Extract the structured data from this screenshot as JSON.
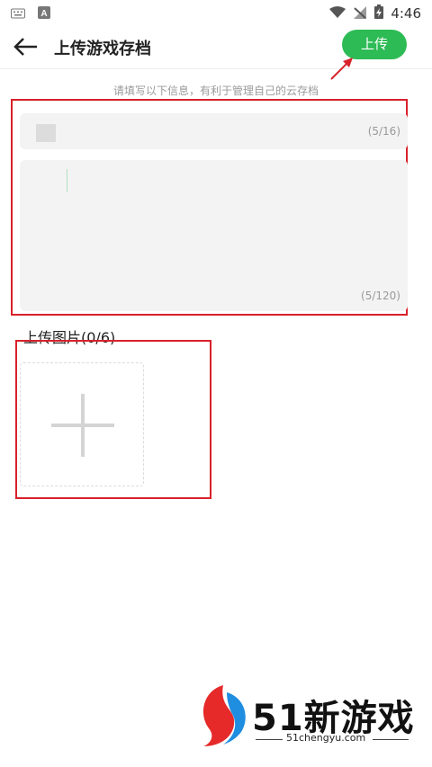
{
  "status_bar": {
    "time": "4:46",
    "icons": [
      "keyboard-icon",
      "a-notification-icon",
      "wifi-icon",
      "signal-off-icon",
      "battery-charging-icon"
    ]
  },
  "header": {
    "title": "上传游戏存档",
    "upload_label": "上传",
    "accent_color": "#2dbb55"
  },
  "form": {
    "hint": "请填写以下信息，有利于管理自己的云存档",
    "name_counter": "(5/16)",
    "description_counter": "(5/120)"
  },
  "images": {
    "heading": "上传图片(0/6)"
  },
  "watermark": {
    "brand": "51新游戏",
    "url": "51chengyu.com"
  },
  "annotation_color": "#d8212a"
}
